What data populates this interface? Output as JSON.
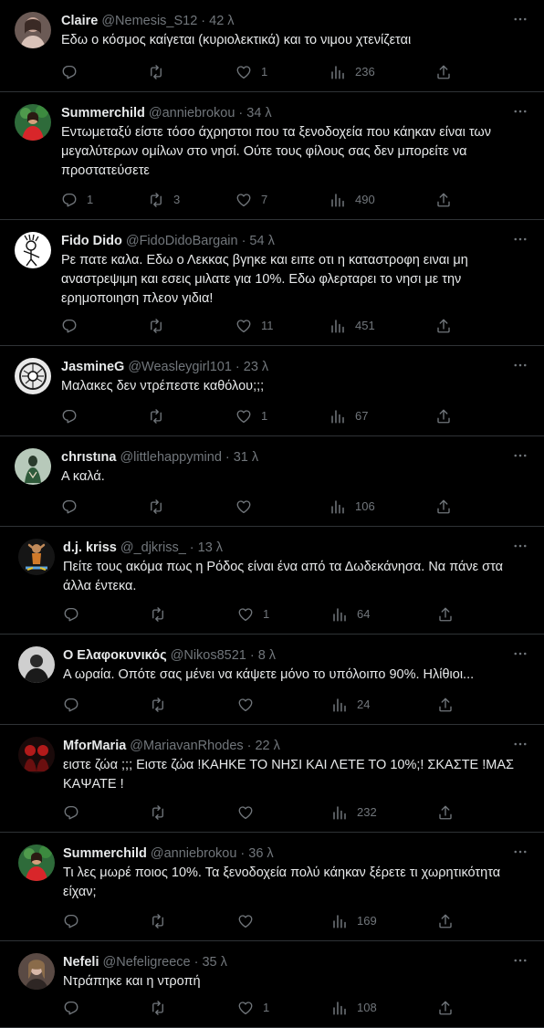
{
  "tweets": [
    {
      "name": "Claire",
      "handle": "@Nemesis_S12",
      "time": "42 λ",
      "text": "Εδω ο κόσμος καίγεται (κυριολεκτικά) και το νιμου χτενίζεται",
      "replies": "",
      "retweets": "",
      "likes": "1",
      "views": "236",
      "avatar": "claire"
    },
    {
      "name": "Summerchild",
      "handle": "@anniebrokou",
      "time": "34 λ",
      "text": "Εντωμεταξύ είστε τόσο άχρηστοι που τα ξενοδοχεία που κάηκαν είναι των μεγαλύτερων ομίλων στο νησί. Ούτε τους φίλους σας δεν μπορείτε να προστατεύσετε",
      "replies": "1",
      "retweets": "3",
      "likes": "7",
      "views": "490",
      "avatar": "summerchild"
    },
    {
      "name": "Fido Dido",
      "handle": "@FidoDidoBargain",
      "time": "54 λ",
      "text": "Ρε πατε καλα. Εδω ο Λεκκας βγηκε και ειπε οτι η καταστροφη ειναι μη αναστρεψιμη και εσεις μιλατε για 10%. Εδω φλερταρει το νησι με την ερημοποιηση πλεον γιδια!",
      "replies": "",
      "retweets": "",
      "likes": "11",
      "views": "451",
      "avatar": "fido"
    },
    {
      "name": "JasmineG",
      "handle": "@Weasleygirl101",
      "time": "23 λ",
      "text": "Μαλακες δεν ντρέπεστε καθόλου;;;",
      "replies": "",
      "retweets": "",
      "likes": "1",
      "views": "67",
      "avatar": "jasmine"
    },
    {
      "name": "chrιstιna",
      "handle": "@littlehappymind",
      "time": "31 λ",
      "text": "Α καλά.",
      "replies": "",
      "retweets": "",
      "likes": "",
      "views": "106",
      "avatar": "christina"
    },
    {
      "name": "d.j. kriss",
      "handle": "@_djkriss_",
      "time": "13 λ",
      "text": "Πείτε τους ακόμα πως η Ρόδος είναι ένα από τα Δωδεκάνησα. Να πάνε στα άλλα έντεκα.",
      "replies": "",
      "retweets": "",
      "likes": "1",
      "views": "64",
      "avatar": "kriss"
    },
    {
      "name": "Ο Ελαφοκυνικός",
      "handle": "@Nikos8521",
      "time": "8 λ",
      "text": "Α ωραία. Οπότε σας μένει να κάψετε μόνο το υπόλοιπο 90%. Ηλίθιοι...",
      "replies": "",
      "retweets": "",
      "likes": "",
      "views": "24",
      "avatar": "elafo"
    },
    {
      "name": "MforMaria",
      "handle": "@MariavanRhodes",
      "time": "22 λ",
      "text": "ειστε ζώα ;;; Ειστε ζώα !ΚΑΗΚΕ ΤΟ ΝΗΣΙ ΚΑΙ ΛΕΤΕ ΤΟ 10%;! ΣΚΑΣΤΕ !ΜΑΣ ΚΑΨΑΤΕ !",
      "replies": "",
      "retweets": "",
      "likes": "",
      "views": "232",
      "avatar": "maria"
    },
    {
      "name": "Summerchild",
      "handle": "@anniebrokou",
      "time": "36 λ",
      "text": "Τι λες μωρέ ποιος 10%. Τα ξενοδοχεία πολύ κάηκαν ξέρετε τι χωρητικότητα είχαν;",
      "replies": "",
      "retweets": "",
      "likes": "",
      "views": "169",
      "avatar": "summerchild"
    },
    {
      "name": "Nefeli",
      "handle": "@Nefeligreece",
      "time": "35 λ",
      "text": "Ντράπηκε και η ντροπή",
      "replies": "",
      "retweets": "",
      "likes": "1",
      "views": "108",
      "avatar": "nefeli"
    }
  ],
  "separator": "·",
  "icons": {
    "reply": "reply-icon",
    "retweet": "retweet-icon",
    "like": "heart-icon",
    "views": "views-chart-icon",
    "share": "share-icon",
    "more": "more-dots-icon"
  },
  "colors": {
    "background": "#000000",
    "text": "#e7e9ea",
    "secondary": "#71767b",
    "border": "#2f3336"
  }
}
